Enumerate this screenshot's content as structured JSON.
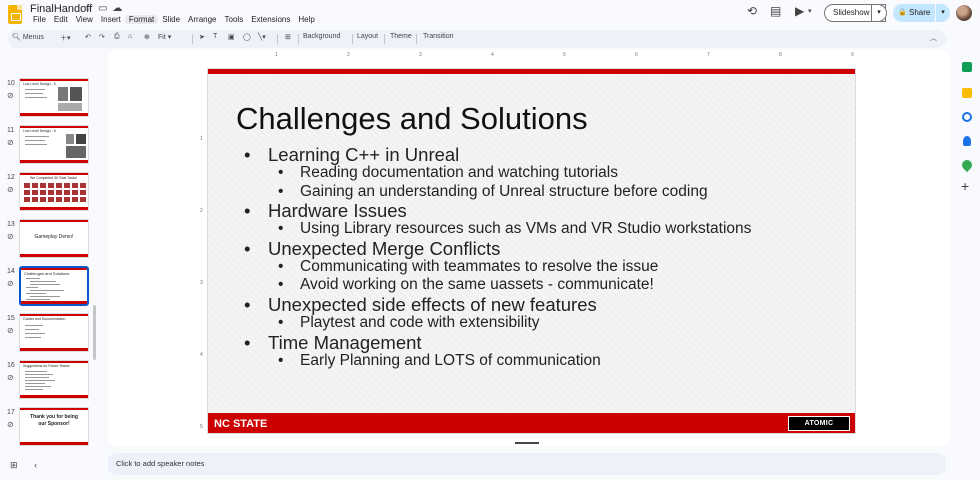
{
  "app": {
    "doc_title": "FinalHandoff",
    "menu": [
      "File",
      "Edit",
      "View",
      "Insert",
      "Format",
      "Slide",
      "Arrange",
      "Tools",
      "Extensions",
      "Help"
    ],
    "active_menu": "Format"
  },
  "header": {
    "slideshow_label": "Slideshow",
    "share_label": "Share"
  },
  "toolbar": {
    "menus_label": "Menus",
    "zoom_label": "Fit",
    "background_label": "Background",
    "layout_label": "Layout",
    "theme_label": "Theme",
    "transition_label": "Transition"
  },
  "filmstrip": [
    {
      "num": "10",
      "title": "Low Level Design - 5"
    },
    {
      "num": "11",
      "title": "Low Level Design - 6"
    },
    {
      "num": "12",
      "title": "We Completed 30 Total Tasks!"
    },
    {
      "num": "13",
      "title": "Gameplay Demo!"
    },
    {
      "num": "14",
      "title": "Challenges and Solutions"
    },
    {
      "num": "15",
      "title": "Guides and Documentation"
    },
    {
      "num": "16",
      "title": "Suggestions for Future Teams"
    },
    {
      "num": "17",
      "title": "Thank you for being our Sponsor!"
    }
  ],
  "ruler": {
    "top": [
      "1",
      "2",
      "3",
      "4",
      "5",
      "6",
      "7",
      "8",
      "9"
    ],
    "left": [
      "1",
      "2",
      "3",
      "4",
      "5"
    ]
  },
  "slide": {
    "title": "Challenges and Solutions",
    "bullets": [
      {
        "level": 1,
        "text": "Learning C++ in Unreal"
      },
      {
        "level": 2,
        "text": "Reading documentation and watching tutorials"
      },
      {
        "level": 2,
        "text": "Gaining an understanding of Unreal structure before coding"
      },
      {
        "level": 1,
        "text": "Hardware Issues"
      },
      {
        "level": 2,
        "text": "Using Library resources such as VMs and VR Studio workstations"
      },
      {
        "level": 1,
        "text": "Unexpected Merge Conflicts"
      },
      {
        "level": 2,
        "text": "Communicating with teammates to resolve the issue"
      },
      {
        "level": 2,
        "text": "Avoid working on the same uassets - communicate!"
      },
      {
        "level": 1,
        "text": "Unexpected side effects of new features"
      },
      {
        "level": 2,
        "text": "Playtest and code with extensibility"
      },
      {
        "level": 1,
        "text": "Time Management"
      },
      {
        "level": 2,
        "text": "Early Planning and LOTS of communication"
      }
    ],
    "footer_left": "NC STATE",
    "footer_right_logo": "ATOMIC ARCADE"
  },
  "notes": {
    "placeholder": "Click to add speaker notes"
  },
  "colors": {
    "accent_red": "#cc0000",
    "selection_blue": "#0b57d0",
    "share_bg": "#c2e7ff"
  }
}
